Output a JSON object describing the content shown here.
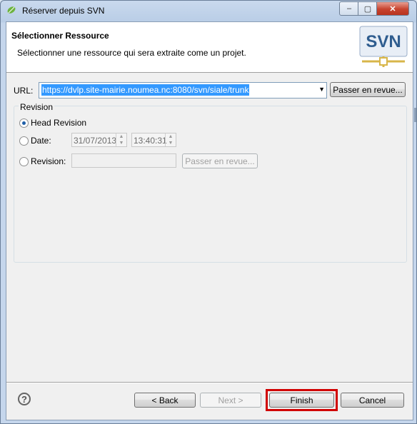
{
  "window": {
    "title": "Réserver depuis SVN",
    "minimize_glyph": "–",
    "maximize_glyph": "▢",
    "close_glyph": "✕"
  },
  "header": {
    "title": "Sélectionner Ressource",
    "description": "Sélectionner une ressource qui sera extraite come un projet.",
    "logo_text": "SVN"
  },
  "url": {
    "label": "URL:",
    "value": "https://dvlp.site-mairie.noumea.nc:8080/svn/siale/trunk",
    "browse_label": "Passer en revue..."
  },
  "revision": {
    "group_label": "Revision",
    "head_label": "Head Revision",
    "date_label": "Date:",
    "date_value": "31/07/2013",
    "time_value": "13:40:31",
    "revision_label": "Revision:",
    "revision_value": "",
    "browse_label": "Passer en revue...",
    "selected": "head"
  },
  "footer": {
    "help_glyph": "?",
    "back_label": "< Back",
    "next_label": "Next >",
    "finish_label": "Finish",
    "cancel_label": "Cancel"
  },
  "colors": {
    "selection": "#3399ff",
    "highlight_border": "#d10000",
    "logo_blue": "#2f5d8f",
    "logo_gold": "#d8b64a"
  }
}
